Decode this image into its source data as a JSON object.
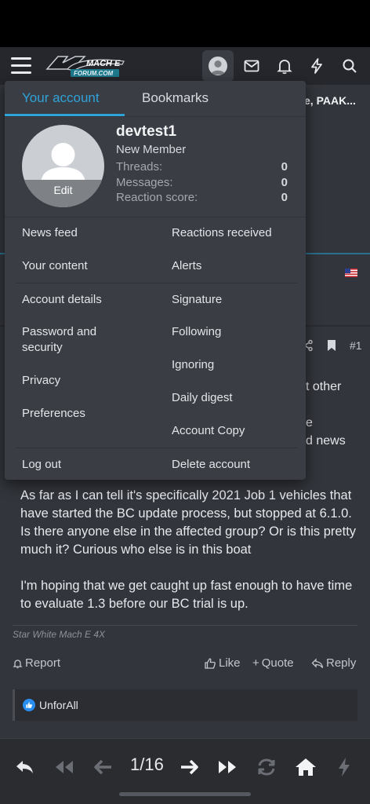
{
  "header": {
    "logo_text": "Mach-E Forum.com",
    "icons": [
      "account-avatar-icon",
      "inbox-icon",
      "bell-icon",
      "bolt-icon",
      "search-icon"
    ]
  },
  "background": {
    "thread_title_fragment": "e, PAAK...",
    "post_number": "#1",
    "fragments": [
      "t other",
      "e",
      "d news"
    ],
    "post_paragraphs": [
      "As far as I can tell it's specifically 2021 Job 1 vehicles that have started the BC update process, but stopped at 6.1.0. Is there anyone else in the affected group? Or is this pretty much it? Curious who else is in this boat",
      "I'm hoping that we get caught up fast enough to have time to evaluate 1.3 before our BC trial is up."
    ],
    "signature": "Star White Mach E 4X",
    "actions": {
      "report": "Report",
      "like": "Like",
      "quote": "Quote",
      "reply": "Reply"
    },
    "reactions_user": "UnforAll"
  },
  "menu": {
    "tabs": {
      "account": "Your account",
      "bookmarks": "Bookmarks"
    },
    "profile": {
      "username": "devtest1",
      "user_title": "New Member",
      "edit_label": "Edit",
      "stats": [
        {
          "label": "Threads:",
          "value": "0"
        },
        {
          "label": "Messages:",
          "value": "0"
        },
        {
          "label": "Reaction score:",
          "value": "0"
        }
      ]
    },
    "left_items": [
      "News feed",
      "Your content",
      "Account details",
      "Password and security",
      "Privacy",
      "Preferences"
    ],
    "right_items": [
      "Reactions received",
      "Alerts",
      "Signature",
      "Following",
      "Ignoring",
      "Daily digest",
      "Account Copy"
    ],
    "log_out": "Log out",
    "delete_account": "Delete account"
  },
  "pagination": {
    "page_label": "1/16"
  },
  "colors": {
    "accent": "#2fa3d8",
    "like_blue": "#2a8df1",
    "page_bg": "#32353b",
    "menu_bg": "#3a3d43"
  }
}
